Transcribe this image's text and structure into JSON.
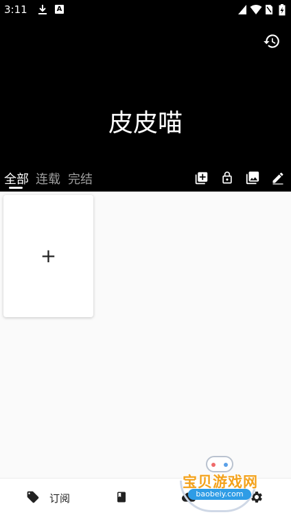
{
  "status_bar": {
    "time": "3:11",
    "a_badge": "A",
    "icons": [
      "download-icon",
      "a-notification-icon",
      "signal-icon",
      "wifi-icon",
      "no-sim-icon",
      "battery-charging-icon"
    ]
  },
  "header": {
    "title": "皮皮喵",
    "history_icon": "history-icon"
  },
  "tabs": [
    {
      "label": "全部",
      "active": true
    },
    {
      "label": "连载",
      "active": false
    },
    {
      "label": "完结",
      "active": false
    }
  ],
  "toolbar": {
    "icons": [
      "add-box-icon",
      "lock-icon",
      "photo-library-icon",
      "edit-icon"
    ]
  },
  "grid": {
    "add_symbol": "+"
  },
  "bottom_nav": {
    "subscribe_label": "订阅",
    "icons": [
      "tag-icon",
      "book-icon",
      "cloud-icon",
      "settings-icon"
    ]
  },
  "watermark": {
    "title": "宝贝游戏网",
    "url": "baobeiy.com"
  },
  "colors": {
    "header_bg": "#000000",
    "inactive_tab": "#9e9e9e",
    "page_bg": "#fafafa",
    "watermark_orange": "#f3a21c",
    "watermark_blue": "#2e9ce6"
  }
}
